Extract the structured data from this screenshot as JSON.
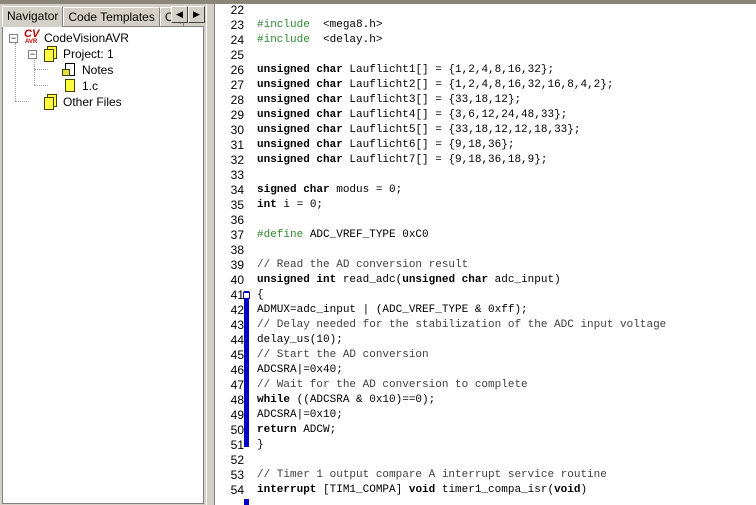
{
  "navigator": {
    "tabs": [
      "Navigator",
      "Code Templates",
      "Clip"
    ],
    "tree": {
      "root": "CodeVisionAVR",
      "root_logo": "CV AVR",
      "project": "Project: 1",
      "notes": "Notes",
      "file": "1.c",
      "other": "Other Files"
    }
  },
  "editor": {
    "lines": [
      {
        "n": "22",
        "c": []
      },
      {
        "n": "23",
        "c": [
          [
            "pp",
            "#include"
          ],
          [
            "",
            "  <mega8.h>"
          ]
        ]
      },
      {
        "n": "24",
        "c": [
          [
            "pp",
            "#include"
          ],
          [
            "",
            "  <delay.h>"
          ]
        ]
      },
      {
        "n": "25",
        "c": []
      },
      {
        "n": "26",
        "c": [
          [
            "kw",
            "unsigned char"
          ],
          [
            "",
            " Lauflicht1[] = {1,2,4,8,16,32};"
          ]
        ]
      },
      {
        "n": "27",
        "c": [
          [
            "kw",
            "unsigned char"
          ],
          [
            "",
            " Lauflicht2[] = {1,2,4,8,16,32,16,8,4,2};"
          ]
        ]
      },
      {
        "n": "28",
        "c": [
          [
            "kw",
            "unsigned char"
          ],
          [
            "",
            " Lauflicht3[] = {33,18,12};"
          ]
        ]
      },
      {
        "n": "29",
        "c": [
          [
            "kw",
            "unsigned char"
          ],
          [
            "",
            " Lauflicht4[] = {3,6,12,24,48,33};"
          ]
        ]
      },
      {
        "n": "30",
        "c": [
          [
            "kw",
            "unsigned char"
          ],
          [
            "",
            " Lauflicht5[] = {33,18,12,12,18,33};"
          ]
        ]
      },
      {
        "n": "31",
        "c": [
          [
            "kw",
            "unsigned char"
          ],
          [
            "",
            " Lauflicht6[] = {9,18,36};"
          ]
        ]
      },
      {
        "n": "32",
        "c": [
          [
            "kw",
            "unsigned char"
          ],
          [
            "",
            " Lauflicht7[] = {9,18,36,18,9};"
          ]
        ]
      },
      {
        "n": "33",
        "c": []
      },
      {
        "n": "34",
        "c": [
          [
            "kw",
            "signed char"
          ],
          [
            "",
            " modus = 0;"
          ]
        ]
      },
      {
        "n": "35",
        "c": [
          [
            "kw",
            "int"
          ],
          [
            "",
            " i = 0;"
          ]
        ]
      },
      {
        "n": "36",
        "c": []
      },
      {
        "n": "37",
        "c": [
          [
            "pp",
            "#define"
          ],
          [
            "",
            " ADC_VREF_TYPE 0xC0"
          ]
        ]
      },
      {
        "n": "38",
        "c": []
      },
      {
        "n": "39",
        "c": [
          [
            "cm",
            "// Read the AD conversion result"
          ]
        ]
      },
      {
        "n": "40",
        "c": [
          [
            "kw",
            "unsigned int"
          ],
          [
            "",
            " read_adc("
          ],
          [
            "kw",
            "unsigned char"
          ],
          [
            "",
            " adc_input)"
          ]
        ]
      },
      {
        "n": "41",
        "c": [
          [
            "",
            "{"
          ]
        ]
      },
      {
        "n": "42",
        "c": [
          [
            "",
            "ADMUX=adc_input | (ADC_VREF_TYPE & 0xff);"
          ]
        ]
      },
      {
        "n": "43",
        "c": [
          [
            "cm",
            "// Delay needed for the stabilization of the ADC input voltage"
          ]
        ]
      },
      {
        "n": "44",
        "c": [
          [
            "",
            "delay_us(10);"
          ]
        ]
      },
      {
        "n": "45",
        "c": [
          [
            "cm",
            "// Start the AD conversion"
          ]
        ]
      },
      {
        "n": "46",
        "c": [
          [
            "",
            "ADCSRA|=0x40;"
          ]
        ]
      },
      {
        "n": "47",
        "c": [
          [
            "cm",
            "// Wait for the AD conversion to complete"
          ]
        ]
      },
      {
        "n": "48",
        "c": [
          [
            "kw",
            "while"
          ],
          [
            "",
            " ((ADCSRA & 0x10)==0);"
          ]
        ]
      },
      {
        "n": "49",
        "c": [
          [
            "",
            "ADCSRA|=0x10;"
          ]
        ]
      },
      {
        "n": "50",
        "c": [
          [
            "kw",
            "return"
          ],
          [
            "",
            " ADCW;"
          ]
        ]
      },
      {
        "n": "51",
        "c": [
          [
            "",
            "}"
          ]
        ]
      },
      {
        "n": "52",
        "c": []
      },
      {
        "n": "53",
        "c": [
          [
            "cm",
            "// Timer 1 output compare A interrupt service routine"
          ]
        ]
      },
      {
        "n": "54",
        "c": [
          [
            "kw",
            "interrupt"
          ],
          [
            "",
            " [TIM1_COMPA] "
          ],
          [
            "kw",
            "void"
          ],
          [
            "",
            " timer1_compa_isr("
          ],
          [
            "kw",
            "void"
          ],
          [
            "",
            ")"
          ]
        ]
      }
    ]
  }
}
